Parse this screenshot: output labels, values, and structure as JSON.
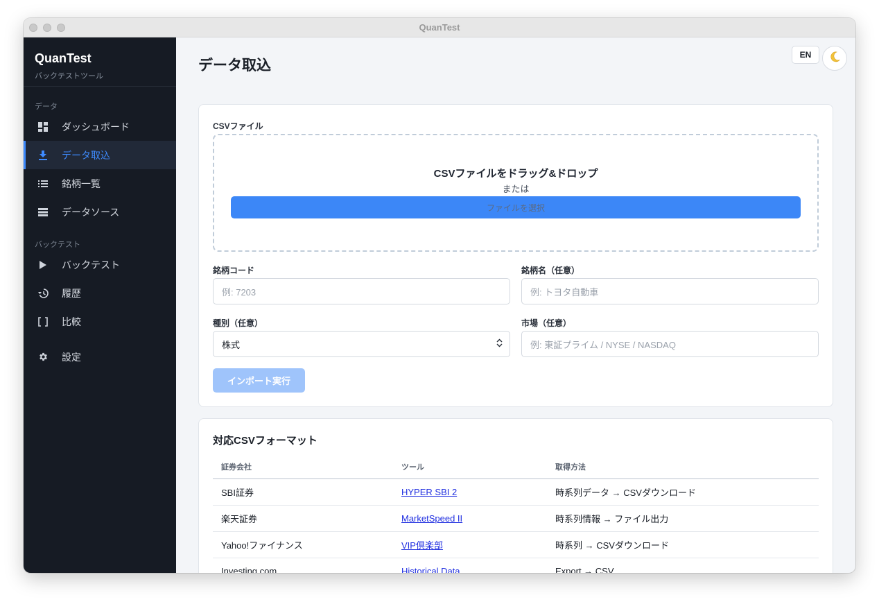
{
  "window": {
    "title": "QuanTest"
  },
  "sidebar": {
    "brand": "QuanTest",
    "subtitle": "バックテストツール",
    "section_data": "データ",
    "section_backtest": "バックテスト",
    "items": [
      {
        "label": "ダッシュボード",
        "icon": "dashboard-icon"
      },
      {
        "label": "データ取込",
        "icon": "download-icon",
        "active": true
      },
      {
        "label": "銘柄一覧",
        "icon": "list-icon"
      },
      {
        "label": "データソース",
        "icon": "storage-icon"
      },
      {
        "label": "バックテスト",
        "icon": "play-icon"
      },
      {
        "label": "履歴",
        "icon": "history-icon"
      },
      {
        "label": "比較",
        "icon": "compare-icon"
      },
      {
        "label": "設定",
        "icon": "gear-icon"
      }
    ]
  },
  "header": {
    "title": "データ取込",
    "lang_button": "EN",
    "theme_icon": "moon-icon"
  },
  "import_form": {
    "csv_label": "CSVファイル",
    "drop_text": "CSVファイルをドラッグ&ドロップ",
    "or_text": "または",
    "select_button": "ファイルを選択",
    "code_label": "銘柄コード",
    "code_placeholder": "例: 7203",
    "name_label": "銘柄名（任意）",
    "name_placeholder": "例: トヨタ自動車",
    "type_label": "種別（任意）",
    "type_value": "株式",
    "market_label": "市場（任意）",
    "market_placeholder": "例: 東証プライム / NYSE / NASDAQ",
    "import_button": "インポート実行"
  },
  "formats": {
    "title": "対応CSVフォーマット",
    "headers": [
      "証券会社",
      "ツール",
      "取得方法"
    ],
    "rows": [
      [
        "SBI証券",
        "HYPER SBI 2",
        "時系列データ → CSVダウンロード"
      ],
      [
        "楽天証券",
        "MarketSpeed II",
        "時系列情報 → ファイル出力"
      ],
      [
        "Yahoo!ファイナンス",
        "VIP倶楽部",
        "時系列 → CSVダウンロード"
      ],
      [
        "Investing.com",
        "Historical Data",
        "Export → CSV"
      ]
    ]
  },
  "colors": {
    "accent": "#3e8bff",
    "sidebar_bg": "#161b24",
    "link": "#1f2ee0"
  }
}
